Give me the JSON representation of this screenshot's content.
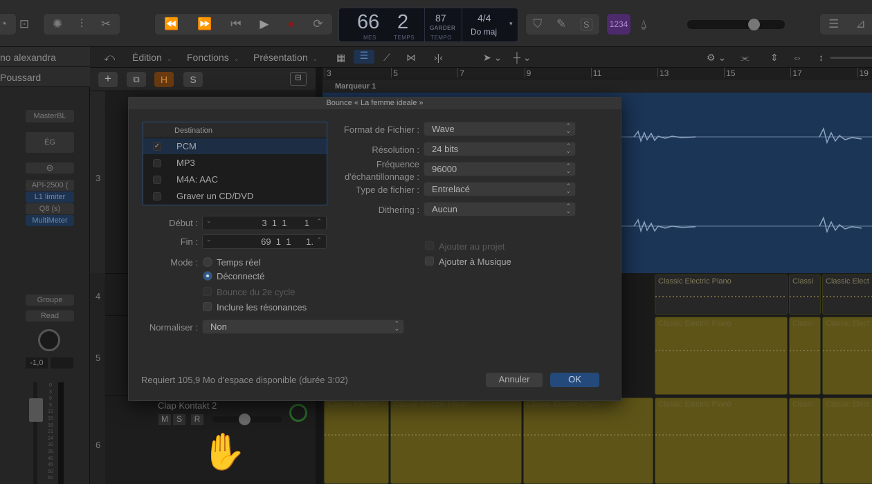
{
  "lcd": {
    "bar": "66",
    "beat": "2",
    "bar_label": "MES",
    "beat_label": "TEMPS",
    "tempo": "87",
    "tempo_mode": "GARDER",
    "tempo_label": "TEMPO",
    "signature": "4/4",
    "key": "Do maj"
  },
  "lcd_count_in": "1234",
  "left_panel": {
    "region_name": "no alexandra",
    "track_name": "Poussard",
    "slots": [
      "MasterBL",
      "ÉG",
      "API-2500 (",
      "L1 limiter",
      "Q8 (s)",
      "MultiMeter"
    ],
    "group_label": "Groupe",
    "automation": "Read",
    "volume_value": "-1,0",
    "meter_ticks": [
      "0",
      "3",
      "6",
      "9",
      "12",
      "15",
      "18",
      "21",
      "24",
      "30",
      "35",
      "40",
      "45",
      "50",
      "60"
    ]
  },
  "menubar": {
    "edit": "Édition",
    "functions": "Fonctions",
    "view": "Présentation"
  },
  "track_toolbar": {
    "add": "+",
    "hide": "H",
    "solo_btn": "S"
  },
  "track_numbers": [
    "3",
    "4",
    "5",
    "6"
  ],
  "track6": {
    "name": "Clap Kontakt 2",
    "m": "M",
    "s": "S",
    "r": "R"
  },
  "ruler": {
    "numbers": [
      "3",
      "5",
      "7",
      "9",
      "11",
      "13",
      "15",
      "17",
      "19"
    ],
    "marker": "Marqueur 1"
  },
  "regions": {
    "piano": "Classic Electric Piano",
    "piano_short": "Classi",
    "piano_left": "Classic Electric",
    "piano_clipped": "Classic Elect"
  },
  "dialog": {
    "title": "Bounce « La femme ideale »",
    "destination_header": "Destination",
    "destinations": [
      {
        "label": "PCM",
        "checked": true
      },
      {
        "label": "MP3",
        "checked": false
      },
      {
        "label": "M4A: AAC",
        "checked": false
      },
      {
        "label": "Graver un CD/DVD",
        "checked": false
      }
    ],
    "start_label": "Début :",
    "start_value": "3  1  1       1",
    "end_label": "Fin :",
    "end_value": "69  1  1      1.",
    "mode_label": "Mode :",
    "mode_realtime": "Temps réel",
    "mode_offline": "Déconnecté",
    "bounce_cycle": "Bounce du 2e cycle",
    "include_tails": "Inclure les résonances",
    "normalize_label": "Normaliser :",
    "normalize_value": "Non",
    "format_label": "Format de Fichier :",
    "format_value": "Wave",
    "resolution_label": "Résolution :",
    "resolution_value": "24 bits",
    "rate_label_1": "Fréquence",
    "rate_label_2": "d'échantillonnage :",
    "rate_value": "96000",
    "filetype_label": "Type de fichier :",
    "filetype_value": "Entrelacé",
    "dither_label": "Dithering :",
    "dither_value": "Aucun",
    "add_project": "Ajouter au projet",
    "add_music": "Ajouter à Musique",
    "space_info": "Requiert 105,9 Mo d'espace disponible (durée 3:02)",
    "cancel": "Annuler",
    "ok": "OK"
  },
  "colors": {
    "region_yellow": "#5e5418",
    "accent_blue": "#2f5a8e",
    "audio_blue": "#1b3557",
    "smart_purple": "#5a2c80"
  }
}
